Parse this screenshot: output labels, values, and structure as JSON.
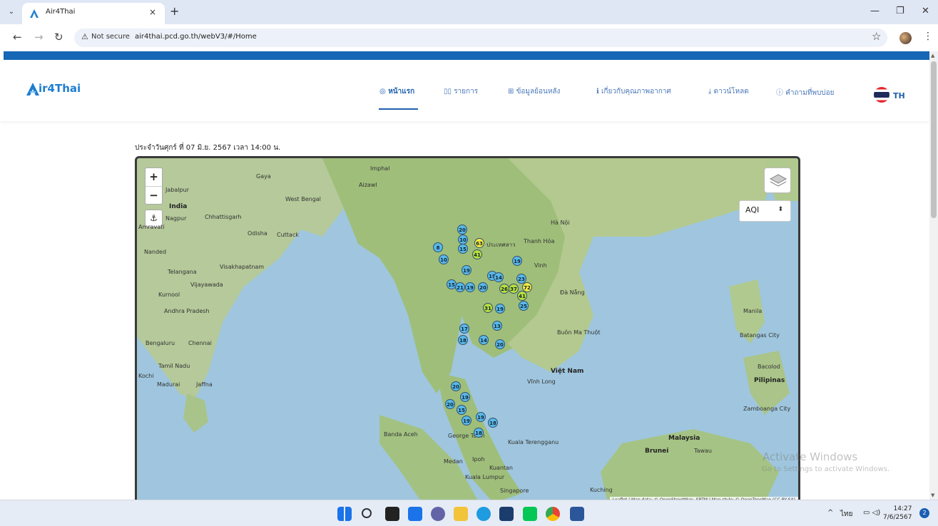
{
  "browser": {
    "tab_title": "Air4Thai",
    "tab_close": "×",
    "new_tab": "+",
    "not_secure": "Not secure",
    "url": "air4thai.pcd.go.th/webV3/#/Home"
  },
  "site": {
    "logo_text": "ir4Thai",
    "nav": [
      {
        "label": "หน้าแรก",
        "icon": "home-pin-icon"
      },
      {
        "label": "รายการ",
        "icon": "grid-icon"
      },
      {
        "label": "ข้อมูลย้อนหลัง",
        "icon": "table-icon"
      },
      {
        "label": "เกี่ยวกับคุณภาพอากาศ",
        "icon": "info-icon"
      },
      {
        "label": "ดาวน์โหลด",
        "icon": "download-icon"
      },
      {
        "label": "คำถามที่พบบ่อย",
        "icon": "help-icon"
      }
    ],
    "lang": "TH",
    "date_text": "ประจำวันศุกร์ ที่ 07 มิ.ย. 2567 เวลา 14:00 น."
  },
  "map": {
    "zoom_in": "+",
    "zoom_out": "−",
    "select_value": "AQI",
    "attribution": "Leaflet | Map data: © OpenStreetMap, SRTM | Map style: © OpenTopoMap (CC-BY-SA)",
    "labels": [
      "Gaya",
      "Jabalpur",
      "India",
      "Nagpur",
      "Amravati",
      "Nanded",
      "Telangana",
      "Visakhapatnam",
      "Vijayawada",
      "Kurnool",
      "Andhra Pradesh",
      "Bengaluru",
      "Chennai",
      "Tamil Nadu",
      "Kochi",
      "Madurai",
      "Jaffna",
      "Imphal",
      "Aizawl",
      "Cuttack",
      "Odisha",
      "Chhattisgarh",
      "West Bengal",
      "Thanh Hóa",
      "Vinh",
      "Đà Nẵng",
      "Buôn Ma Thuột",
      "Việt Nam",
      "Vĩnh Long",
      "Hà Nội",
      "Manila",
      "Batangas City",
      "Bacolod",
      "Pilipinas",
      "Zamboanga City",
      "Banda Aceh",
      "Medan",
      "George Town",
      "Ipoh",
      "Kuala Terengganu",
      "Kuantan",
      "Kuala Lumpur",
      "Singapore",
      "Kuching",
      "Malaysia",
      "Brunei",
      "Tawau",
      "India label",
      "ประเทศลาว"
    ],
    "aqi_values": [
      "20",
      "10",
      "63",
      "15",
      "8",
      "41",
      "10",
      "19",
      "19",
      "15",
      "21",
      "19",
      "20",
      "19",
      "14",
      "23",
      "26",
      "37",
      "72",
      "41",
      "31",
      "19",
      "25",
      "17",
      "18",
      "14",
      "13",
      "20",
      "20",
      "19",
      "20",
      "15",
      "19",
      "19",
      "18",
      "18"
    ]
  },
  "watermark": {
    "line1": "Activate Windows",
    "line2": "Go to Settings to activate Windows."
  },
  "taskbar": {
    "lang": "ไทย",
    "time": "14:27",
    "date": "7/6/2567",
    "notifications": "2"
  }
}
